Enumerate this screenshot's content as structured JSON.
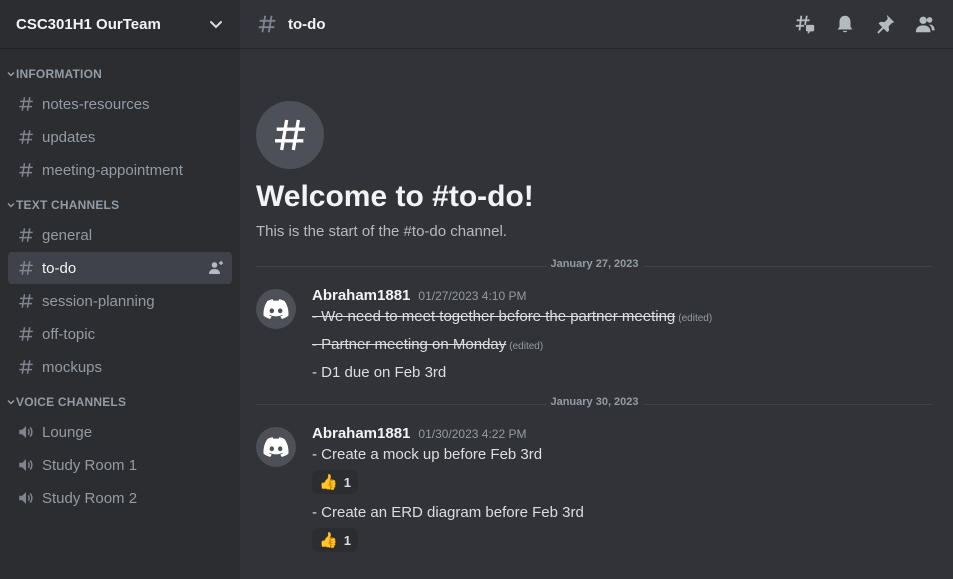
{
  "server": {
    "name": "CSC301H1 OurTeam"
  },
  "sidebar": {
    "categories": [
      {
        "name": "INFORMATION",
        "channels": [
          "notes-resources",
          "updates",
          "meeting-appointment"
        ]
      },
      {
        "name": "TEXT CHANNELS",
        "channels": [
          "general",
          "to-do",
          "session-planning",
          "off-topic",
          "mockups"
        ]
      },
      {
        "name": "VOICE CHANNELS",
        "channels": [
          "Lounge",
          "Study Room 1",
          "Study Room 2"
        ]
      }
    ],
    "active_channel": "to-do"
  },
  "topbar": {
    "channel": "to-do",
    "icons": [
      "threads-icon",
      "bell-icon",
      "pin-icon",
      "members-icon"
    ]
  },
  "welcome": {
    "title": "Welcome to #to-do!",
    "subtitle": "This is the start of the #to-do channel."
  },
  "messages": [
    {
      "date": "January 27, 2023",
      "author": "Abraham1881",
      "timestamp": "01/27/2023 4:10 PM",
      "lines": [
        {
          "text": "- We need to meet together before the partner meeting",
          "struck": true,
          "edited": "(edited)"
        },
        {
          "text": "- Partner meeting on Monday",
          "struck": true,
          "edited": "(edited)"
        },
        {
          "text": "- D1 due on Feb 3rd"
        }
      ]
    },
    {
      "date": "January 30, 2023",
      "author": "Abraham1881",
      "timestamp": "01/30/2023 4:22 PM",
      "lines": [
        {
          "text": "- Create a mock up before Feb 3rd"
        },
        {
          "text": "- Create an ERD diagram before Feb 3rd"
        }
      ],
      "reactions": [
        {
          "emoji": "👍",
          "count": "1"
        },
        {
          "emoji": "👍",
          "count": "1"
        }
      ]
    }
  ],
  "colors": {
    "sidebar_bg": "#2b2d31",
    "main_bg": "#313338",
    "active_channel_bg": "#404249"
  }
}
